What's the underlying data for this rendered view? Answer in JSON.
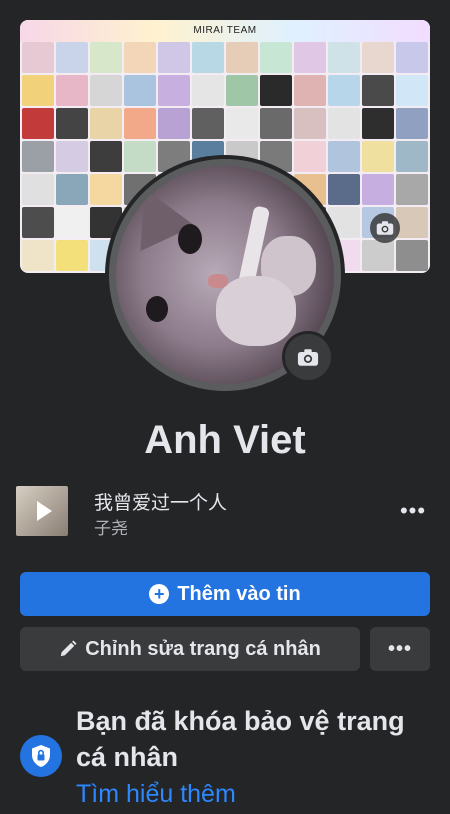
{
  "cover": {
    "title": "MIRAI TEAM",
    "tile_colors": [
      "#e7c9d3",
      "#c9d3ea",
      "#d7e7c9",
      "#f3d6b8",
      "#d0c7e6",
      "#b8d8e6",
      "#e6cdb8",
      "#c7e6d4",
      "#e0c7e6",
      "#cfe2e8",
      "#e8d7cf",
      "#c8c8ea",
      "#f1d27a",
      "#e7b7c8",
      "#d6d6d6",
      "#aac4e0",
      "#c7b0e0",
      "#e5e5e5",
      "#9fc7a7",
      "#2a2a2a",
      "#e0b3b3",
      "#b7d6ea",
      "#4a4a4a",
      "#d1e7f7",
      "#c23a3a",
      "#444444",
      "#e8d4a7",
      "#f2a98a",
      "#b8a2d4",
      "#606060",
      "#e9e9e9",
      "#6a6a6a",
      "#d9c0c0",
      "#e3e3e3",
      "#2e2e2e",
      "#8fa0c0",
      "#9aa0a6",
      "#d5cbe2",
      "#3d3d3d",
      "#c4dcc6",
      "#7d7d7d",
      "#5a7f9e",
      "#c9c9c9",
      "#7a7a7a",
      "#f2d0d8",
      "#b0c4de",
      "#f0e0a0",
      "#9eb8c8",
      "#e0e0e0",
      "#8aa7b9",
      "#f5d8a0",
      "#707070",
      "#aab0ba",
      "#cfcfcf",
      "#dcdcdc",
      "#d7b8e8",
      "#e8c090",
      "#5b6b8a",
      "#c6aee0",
      "#a8a8a8",
      "#4d4d4d",
      "#f0f0f0",
      "#333333",
      "#bbbbbb",
      "#ddd0e8",
      "#999999",
      "#e6d3b3",
      "#c0c0c0",
      "#4f4f4f",
      "#e2e2e2",
      "#b7c9e2",
      "#d8c8b8",
      "#efe3c8",
      "#f4e07a",
      "#cfe0ef",
      "#777777",
      "#bdb3c7",
      "#e9d9e9",
      "#a0a0a0",
      "#c8b8d8",
      "#dbe7f1",
      "#f1dcef",
      "#cccccc",
      "#8e8e8e"
    ]
  },
  "profile": {
    "name": "Anh Viet"
  },
  "music": {
    "title": "我曾爱过一个人",
    "artist": "子尧",
    "more": "•••"
  },
  "actions": {
    "add_story_label": "Thêm vào tin",
    "edit_profile_label": "Chỉnh sửa trang cá nhân",
    "more_label": "•••"
  },
  "lock_notice": {
    "title": "Bạn đã khóa bảo vệ trang cá nhân",
    "link": "Tìm hiểu thêm"
  },
  "colors": {
    "background": "#242526",
    "primary": "#2374e1",
    "secondary_button": "#3a3b3c",
    "link": "#2d88ff"
  }
}
